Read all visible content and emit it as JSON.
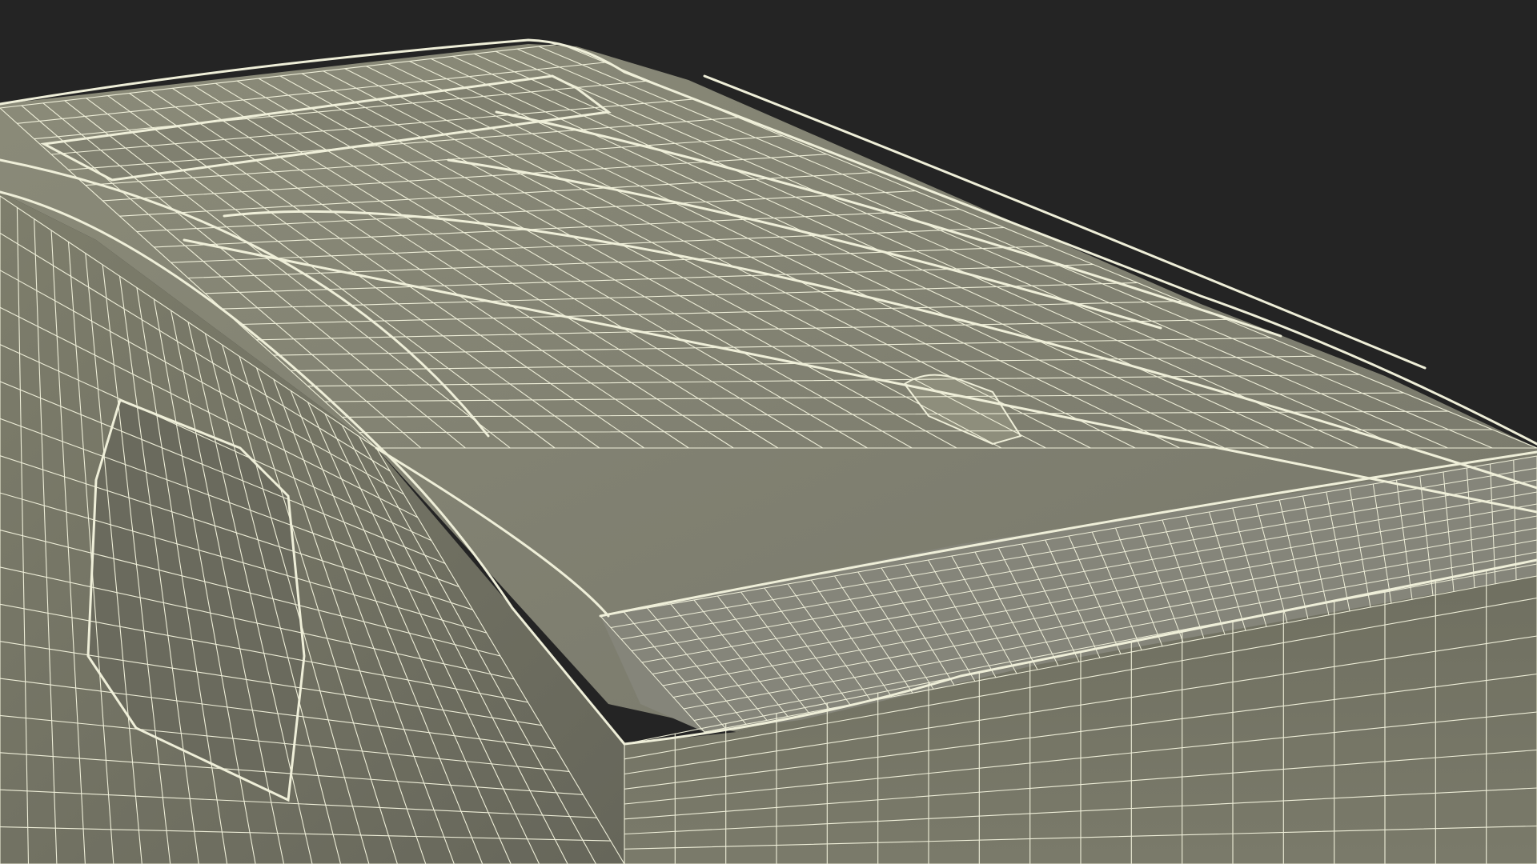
{
  "scene": {
    "subject": "wireframe-3d-van-roof-rear",
    "colors": {
      "background": "#242424",
      "surface_light": "#8a8a78",
      "surface_mid": "#7b7b69",
      "surface_dark": "#6c6c5c",
      "surface_shadow": "#5f5f51",
      "wire": "#efefd9",
      "wire_bright": "#ffffff"
    }
  }
}
